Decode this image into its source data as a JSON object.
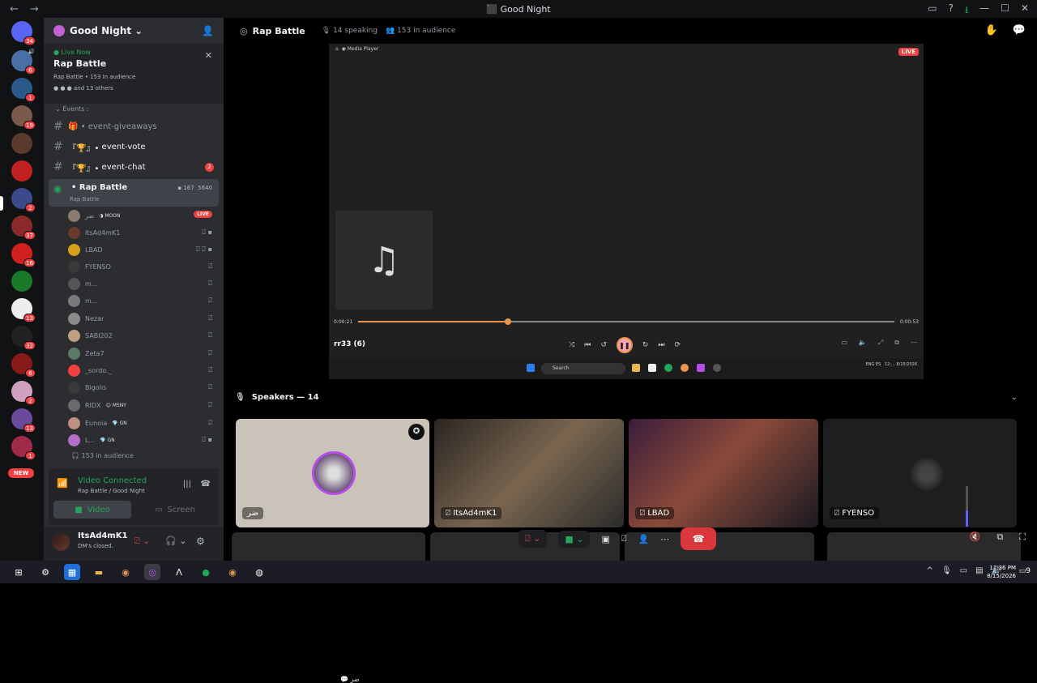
{
  "window": {
    "title": "Good Night",
    "nav_back": "←",
    "nav_forward": "→",
    "btn_inbox": "▭",
    "btn_help": "?",
    "btn_download": "⭳",
    "btn_min": "—",
    "btn_max": "☐",
    "btn_close": "✕"
  },
  "guilds": {
    "badges": [
      "34",
      "6",
      "1",
      "19",
      "2",
      "37",
      "16",
      "13",
      "32",
      "6",
      "2",
      "13",
      "1"
    ],
    "new_label": "NEW"
  },
  "server": {
    "name": "Good Night",
    "chevron": "⌄",
    "add_icon": "👤"
  },
  "live_card": {
    "live_label": "● Live Now",
    "title": "Rap Battle",
    "subtitle": "Rap Battle • 153 in audience",
    "others": "and 13 others",
    "close": "✕"
  },
  "events_category": "Events",
  "channels": [
    {
      "name": "event-giveaways",
      "prefix": "🎁 •"
    },
    {
      "name": "event-vote",
      "prefix": "『🏆』•"
    },
    {
      "name": "event-chat",
      "prefix": "『🏆』•",
      "badge": "2"
    }
  ],
  "stage_channel": {
    "name": "• Rap Battle",
    "sub": "Rap Battle",
    "video_count": "167",
    "listeners": "5640",
    "icon": "◉"
  },
  "members": [
    {
      "name": "ضر",
      "tag": "◑ MOON",
      "badge": "LIVE",
      "color": "#8a7a70"
    },
    {
      "name": "ItsAd4mK1",
      "icons": "⍁ ▪",
      "color": "#6a3a2a"
    },
    {
      "name": "LBAD",
      "icons": "⍁ ⍁ ▪",
      "color": "#d4a017"
    },
    {
      "name": "FYENSO",
      "icons": "⍁",
      "color": "#3a3a3a"
    },
    {
      "name": "m...",
      "icons": "⍁",
      "color": "#555"
    },
    {
      "name": "m...",
      "icons": "⍁",
      "color": "#7a7a7a"
    },
    {
      "name": "Nezar",
      "icons": "⍁",
      "color": "#8a8a8a"
    },
    {
      "name": "SABI202",
      "icons": "⍁",
      "color": "#c0a080"
    },
    {
      "name": "Zeta7",
      "icons": "⍁",
      "color": "#5a7a6a"
    },
    {
      "name": "_sordo._",
      "icons": "⍁",
      "color": "#f23f42"
    },
    {
      "name": "Bigolis",
      "icons": "⍁",
      "color": "#3a3a3a"
    },
    {
      "name": "RIDX",
      "tag": "😊 MSNY",
      "icons": "⍁",
      "color": "#6a6a6a"
    },
    {
      "name": "Eunoia",
      "tag": "💎 GN",
      "icons": "⍁",
      "color": "#c09080"
    },
    {
      "name": "L...",
      "tag": "💎 GN",
      "icons": "⍁ ▪",
      "color": "#b46ec8"
    }
  ],
  "audience": "153 in audience",
  "voice_connection": {
    "status": "Video Connected",
    "location": "Rap Battle / Good Night",
    "video_btn": "Video",
    "screen_btn": "Screen"
  },
  "user": {
    "name": "ItsAd4mK1",
    "status": "DM's closed."
  },
  "main_header": {
    "title": "Rap Battle",
    "speaking": "14 speaking",
    "audience": "153 in audience"
  },
  "stream": {
    "app": "Media Player",
    "live": "LIVE",
    "elapsed": "0:00:21",
    "total": "0:00:53",
    "progress": 0.28,
    "song": "rr33 (6)",
    "search_placeholder": "Search",
    "lang": "ENG ES",
    "clock": "12:... 8/15/2026",
    "chat_label": "ضر"
  },
  "speakers_header": "Speakers — 14",
  "tiles": [
    {
      "name": "ضر"
    },
    {
      "name": "ItsAd4mK1"
    },
    {
      "name": "LBAD"
    },
    {
      "name": "FYENSO"
    }
  ],
  "taskbar": {
    "time": "11:36 PM",
    "date": "8/15/2026",
    "notif": "9"
  },
  "accent": "#5865f2",
  "live_color": "#f23f42",
  "connected_color": "#23a55a"
}
